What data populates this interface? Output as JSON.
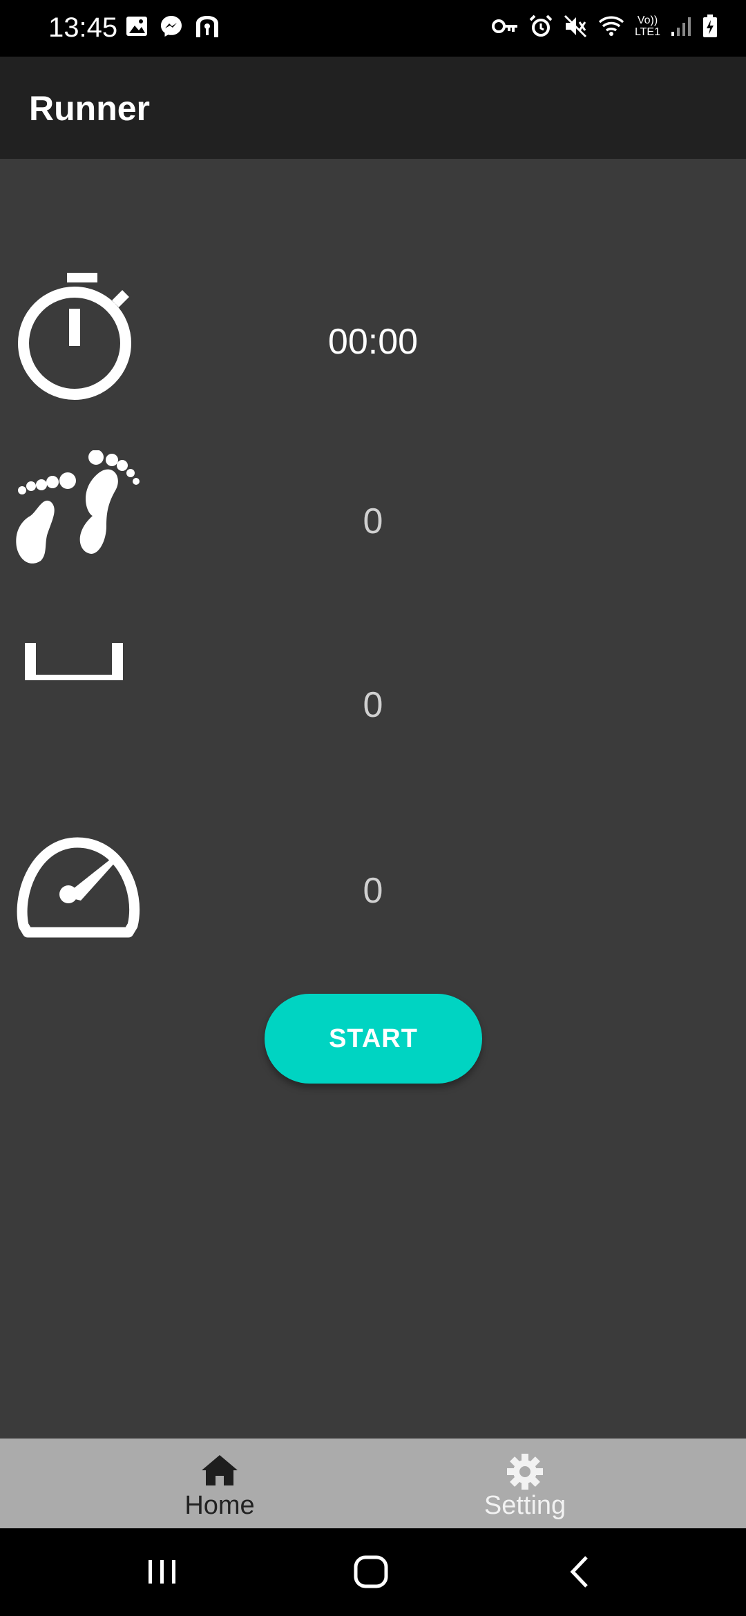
{
  "status_bar": {
    "time": "13:45",
    "network_label_top": "Vo))",
    "network_label_bottom": "LTE1",
    "left_icons": [
      "gallery-icon",
      "messenger-icon",
      "vpn-tunnel-icon"
    ],
    "right_icons": [
      "key-icon",
      "alarm-icon",
      "mute-icon",
      "wifi-icon",
      "signal-icon",
      "battery-charging-icon"
    ]
  },
  "app_bar": {
    "title": "Runner"
  },
  "stats": {
    "timer_value": "00:00",
    "steps_value": "0",
    "distance_value": "0",
    "speed_value": "0"
  },
  "icons": {
    "timer": "stopwatch-icon",
    "steps": "footprints-icon",
    "distance": "distance-icon",
    "speed": "speedometer-icon"
  },
  "actions": {
    "start_label": "START"
  },
  "bottom_nav": {
    "home_label": "Home",
    "setting_label": "Setting"
  },
  "colors": {
    "background": "#3b3b3b",
    "app_bar": "#212121",
    "accent": "#00d4c2",
    "bottom_nav": "#ababab"
  }
}
